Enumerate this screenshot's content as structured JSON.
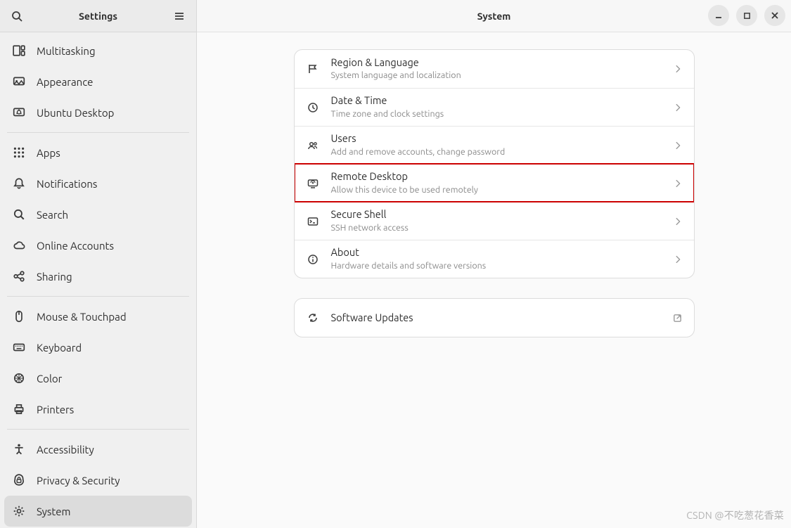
{
  "sidebar": {
    "title": "Settings",
    "groups": [
      [
        {
          "icon": "multitasking-icon",
          "label": "Multitasking"
        },
        {
          "icon": "appearance-icon",
          "label": "Appearance"
        },
        {
          "icon": "ubuntu-desktop-icon",
          "label": "Ubuntu Desktop"
        }
      ],
      [
        {
          "icon": "apps-icon",
          "label": "Apps"
        },
        {
          "icon": "notifications-icon",
          "label": "Notifications"
        },
        {
          "icon": "search-icon",
          "label": "Search"
        },
        {
          "icon": "cloud-icon",
          "label": "Online Accounts"
        },
        {
          "icon": "sharing-icon",
          "label": "Sharing"
        }
      ],
      [
        {
          "icon": "mouse-icon",
          "label": "Mouse & Touchpad"
        },
        {
          "icon": "keyboard-icon",
          "label": "Keyboard"
        },
        {
          "icon": "color-icon",
          "label": "Color"
        },
        {
          "icon": "printers-icon",
          "label": "Printers"
        }
      ],
      [
        {
          "icon": "accessibility-icon",
          "label": "Accessibility"
        },
        {
          "icon": "privacy-icon",
          "label": "Privacy & Security"
        },
        {
          "icon": "system-icon",
          "label": "System",
          "active": true
        }
      ]
    ]
  },
  "main": {
    "title": "System",
    "rows": [
      {
        "icon": "flag-icon",
        "title": "Region & Language",
        "subtitle": "System language and localization"
      },
      {
        "icon": "clock-icon",
        "title": "Date & Time",
        "subtitle": "Time zone and clock settings"
      },
      {
        "icon": "users-icon",
        "title": "Users",
        "subtitle": "Add and remove accounts, change password"
      },
      {
        "icon": "remote-desktop-icon",
        "title": "Remote Desktop",
        "subtitle": "Allow this device to be used remotely",
        "highlight": true
      },
      {
        "icon": "terminal-icon",
        "title": "Secure Shell",
        "subtitle": "SSH network access"
      },
      {
        "icon": "about-icon",
        "title": "About",
        "subtitle": "Hardware details and software versions"
      }
    ],
    "updates": {
      "icon": "refresh-icon",
      "title": "Software Updates",
      "link_icon": "external-link-icon"
    }
  },
  "watermark": "CSDN @不吃葱花香菜"
}
